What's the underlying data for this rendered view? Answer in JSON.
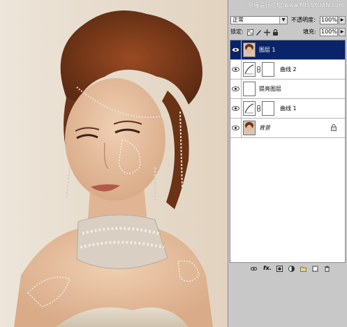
{
  "watermark": "思缘设计论坛 www.MISSYUAN.com",
  "blend": {
    "mode": "正常",
    "opacity_label": "不透明度:",
    "opacity_value": "100%",
    "lock_label": "锁定:",
    "fill_label": "填充:",
    "fill_value": "100%"
  },
  "layers": [
    {
      "name": "图层 1",
      "kind": "photo",
      "selected": true
    },
    {
      "name": "曲线 2",
      "kind": "curves",
      "selected": false
    },
    {
      "name": "提亮图层",
      "kind": "blank",
      "selected": false
    },
    {
      "name": "曲线 1",
      "kind": "curves",
      "selected": false
    },
    {
      "name": "背景",
      "kind": "photo",
      "selected": false,
      "locked": true
    }
  ],
  "icons": {
    "eye": "eye-icon",
    "link_layers": "link-icon",
    "fx": "fx-icon",
    "mask": "mask-icon",
    "adjustment": "adjustment-icon",
    "group": "folder-icon",
    "new_layer": "new-layer-icon",
    "delete": "trash-icon",
    "fx_text": "fx."
  },
  "colors": {
    "selected_row": "#0a246a",
    "panel_bg": "#c8c8c8"
  }
}
